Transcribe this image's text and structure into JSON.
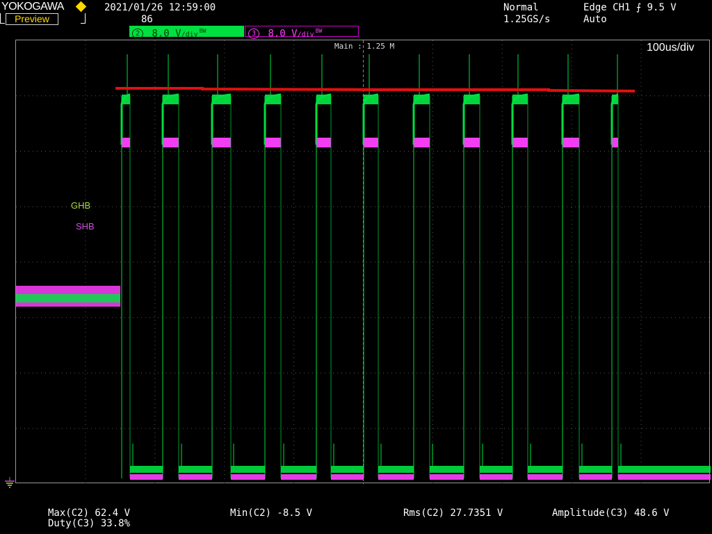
{
  "header": {
    "brand": "YOKOGAWA",
    "preview_label": "Preview",
    "datetime": "2021/01/26 12:59:00",
    "count": "86",
    "acq_mode": "Normal",
    "sample_rate": "1.25GS/s",
    "trigger": "Edge CH1 ⨍ 9.5 V",
    "trigger_mode": "Auto"
  },
  "channels": [
    {
      "num": "2",
      "scale": "8.0 V",
      "unit": "/div",
      "bw": "BW",
      "color": "#00e040"
    },
    {
      "num": "3",
      "scale": "8.0 V",
      "unit": "/div",
      "bw": "BW",
      "color": "#ff40ff"
    }
  ],
  "screen": {
    "main_label": "Main : 1.25 M",
    "timebase": "100us/div",
    "trace_labels": {
      "ghb": "GHB",
      "shb": "SHB"
    },
    "grid_divisions": {
      "horizontal": 10,
      "vertical": 8
    }
  },
  "measurements": {
    "max": "Max(C2)  62.4 V",
    "duty": "Duty(C3) 33.8%",
    "min": "Min(C2) -8.5 V",
    "rms": "Rms(C2)  27.7351 V",
    "amplitude": "Amplitude(C3)  48.6 V"
  },
  "colors": {
    "ch2": "#00e040",
    "ch3": "#ff40ff",
    "marker_line": "#e01010",
    "grid": "#777777"
  }
}
